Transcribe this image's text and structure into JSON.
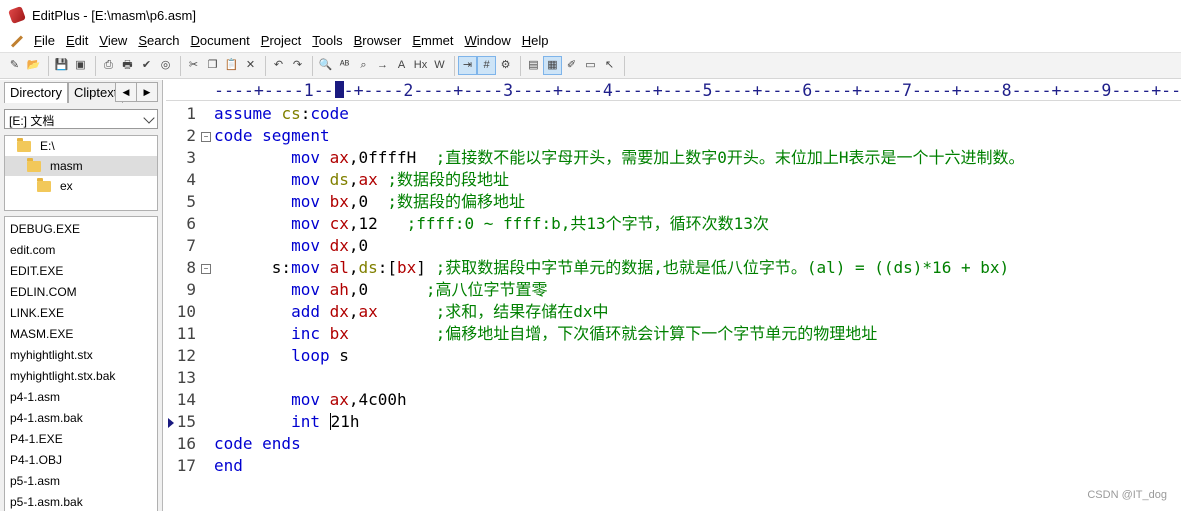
{
  "window": {
    "title": "EditPlus - [E:\\masm\\p6.asm]"
  },
  "menu": [
    "File",
    "Edit",
    "View",
    "Search",
    "Document",
    "Project",
    "Tools",
    "Browser",
    "Emmet",
    "Window",
    "Help"
  ],
  "toolbar_icons": [
    "new-file",
    "open",
    "save",
    "save-all",
    "print-preview",
    "print",
    "spell-check",
    "browser",
    "cut",
    "copy",
    "paste",
    "delete",
    "undo",
    "redo",
    "find",
    "replace",
    "find-in-files",
    "goto",
    "font",
    "hex",
    "word-wrap",
    "indent",
    "line-numbers",
    "settings",
    "panel",
    "directory",
    "cliptext",
    "output",
    "help-pointer"
  ],
  "sidebar": {
    "tabs": [
      "Directory",
      "Cliptext"
    ],
    "drive": "[E:] 文档",
    "tree": [
      {
        "label": "E:\\",
        "indent": 0
      },
      {
        "label": "masm",
        "indent": 1
      },
      {
        "label": "ex",
        "indent": 2
      }
    ],
    "files": [
      "DEBUG.EXE",
      "edit.com",
      "EDIT.EXE",
      "EDLIN.COM",
      "LINK.EXE",
      "MASM.EXE",
      "myhightlight.stx",
      "myhightlight.stx.bak",
      "p4-1.asm",
      "p4-1.asm.bak",
      "P4-1.EXE",
      "P4-1.OBJ",
      "p5-1.asm",
      "p5-1.asm.bak"
    ]
  },
  "ruler": "----+----1----+----2----+----3----+----4----+----5----+----6----+----7----+----8----+----9----+--",
  "editor": {
    "line_numbers": [
      "1",
      "2",
      "3",
      "4",
      "5",
      "6",
      "7",
      "8",
      "9",
      "10",
      "11",
      "12",
      "13",
      "14",
      "15",
      "16",
      "17"
    ],
    "lines": [
      [
        {
          "t": "assume ",
          "c": "kw"
        },
        {
          "t": "cs",
          "c": "seg"
        },
        {
          "t": ":",
          "c": "plain"
        },
        {
          "t": "code",
          "c": "kw"
        }
      ],
      [
        {
          "t": "code segment",
          "c": "kw"
        }
      ],
      [
        {
          "t": "        mov ",
          "c": "kw"
        },
        {
          "t": "ax",
          "c": "reg"
        },
        {
          "t": ",0ffffH  ",
          "c": "plain"
        },
        {
          "t": ";直接数不能以字母开头，需要加上数字0开头。末位加上H表示是一个十六进制数。",
          "c": "cm"
        }
      ],
      [
        {
          "t": "        mov ",
          "c": "kw"
        },
        {
          "t": "ds",
          "c": "seg"
        },
        {
          "t": ",",
          "c": "plain"
        },
        {
          "t": "ax",
          "c": "reg"
        },
        {
          "t": " ",
          "c": "plain"
        },
        {
          "t": ";数据段的段地址",
          "c": "cm"
        }
      ],
      [
        {
          "t": "        mov ",
          "c": "kw"
        },
        {
          "t": "bx",
          "c": "reg"
        },
        {
          "t": ",0  ",
          "c": "plain"
        },
        {
          "t": ";数据段的偏移地址",
          "c": "cm"
        }
      ],
      [
        {
          "t": "        mov ",
          "c": "kw"
        },
        {
          "t": "cx",
          "c": "reg"
        },
        {
          "t": ",12   ",
          "c": "plain"
        },
        {
          "t": ";ffff:0 ~ ffff:b,共13个字节，循环次数13次",
          "c": "cm"
        }
      ],
      [
        {
          "t": "        mov ",
          "c": "kw"
        },
        {
          "t": "dx",
          "c": "reg"
        },
        {
          "t": ",0",
          "c": "plain"
        }
      ],
      [
        {
          "t": "      s:",
          "c": "plain"
        },
        {
          "t": "mov ",
          "c": "kw"
        },
        {
          "t": "al",
          "c": "reg"
        },
        {
          "t": ",",
          "c": "plain"
        },
        {
          "t": "ds",
          "c": "seg"
        },
        {
          "t": ":[",
          "c": "plain"
        },
        {
          "t": "bx",
          "c": "reg"
        },
        {
          "t": "] ",
          "c": "plain"
        },
        {
          "t": ";获取数据段中字节单元的数据,也就是低八位字节。(al) = ((ds)*16 + bx)",
          "c": "cm"
        }
      ],
      [
        {
          "t": "        mov ",
          "c": "kw"
        },
        {
          "t": "ah",
          "c": "reg"
        },
        {
          "t": ",0      ",
          "c": "plain"
        },
        {
          "t": ";高八位字节置零",
          "c": "cm"
        }
      ],
      [
        {
          "t": "        add ",
          "c": "kw"
        },
        {
          "t": "dx",
          "c": "reg"
        },
        {
          "t": ",",
          "c": "plain"
        },
        {
          "t": "ax",
          "c": "reg"
        },
        {
          "t": "      ",
          "c": "plain"
        },
        {
          "t": ";求和，结果存储在dx中",
          "c": "cm"
        }
      ],
      [
        {
          "t": "        inc ",
          "c": "kw"
        },
        {
          "t": "bx",
          "c": "reg"
        },
        {
          "t": "         ",
          "c": "plain"
        },
        {
          "t": ";偏移地址自增，下次循环就会计算下一个字节单元的物理地址",
          "c": "cm"
        }
      ],
      [
        {
          "t": "        loop ",
          "c": "kw"
        },
        {
          "t": "s",
          "c": "plain"
        }
      ],
      [],
      [
        {
          "t": "        mov ",
          "c": "kw"
        },
        {
          "t": "ax",
          "c": "reg"
        },
        {
          "t": ",4c00h",
          "c": "plain"
        }
      ],
      [
        {
          "t": "        int ",
          "c": "kw"
        },
        {
          "t": "|",
          "c": "cursor"
        },
        {
          "t": "21h",
          "c": "plain"
        }
      ],
      [
        {
          "t": "code ends",
          "c": "kw"
        }
      ],
      [
        {
          "t": "end",
          "c": "kw"
        }
      ]
    ],
    "fold_lines": [
      2,
      8
    ],
    "current_line": 15
  },
  "watermark": "CSDN @IT_dog"
}
